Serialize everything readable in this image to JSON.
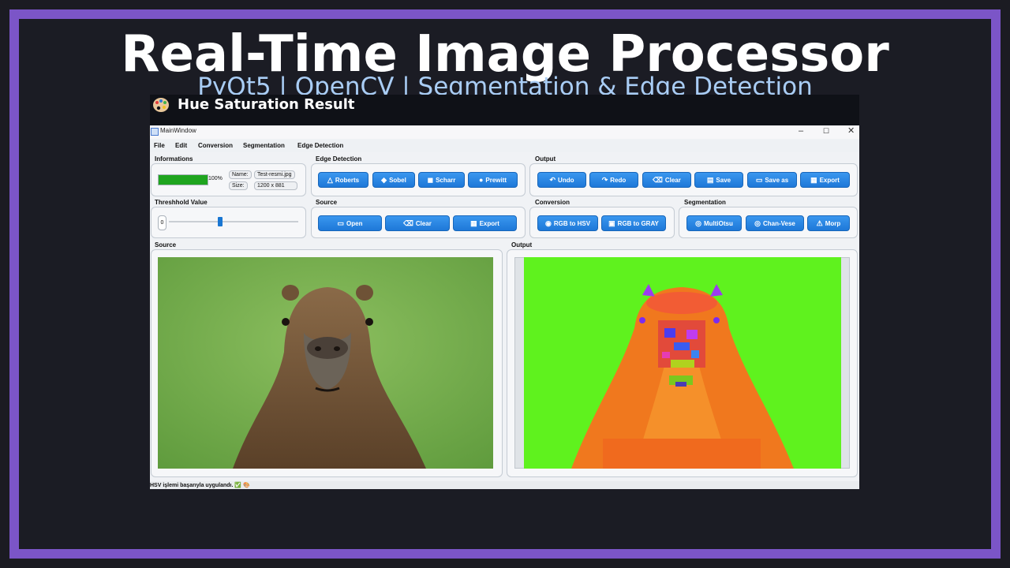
{
  "banner": {
    "title": "Real-Time Image Processor",
    "subtitle": "PyQt5 | OpenCV | Segmentation & Edge Detection"
  },
  "result_bar": {
    "title": "Hue Saturation Result",
    "icon": "palette-icon"
  },
  "window": {
    "title": "MainWindow",
    "controls": {
      "minimize": "–",
      "maximize": "☐",
      "close": "✕"
    }
  },
  "menu": [
    "File",
    "Edit",
    "Conversion",
    "Segmentation",
    "Edge Detection"
  ],
  "informations": {
    "label": "Informations",
    "progress": 1.0,
    "progress_text": "100%",
    "name_label": "Name:",
    "name_value": "Test-resmi.jpg",
    "size_label": "Size:",
    "size_value": "1200 x 881"
  },
  "edge_detection": {
    "label": "Edge Detection",
    "buttons": [
      "Roberts",
      "Sobel",
      "Scharr",
      "Prewitt"
    ]
  },
  "output_group": {
    "label": "Output",
    "buttons": [
      "Undo",
      "Redo",
      "Clear",
      "Save",
      "Save as",
      "Export"
    ]
  },
  "threshold": {
    "label": "Threshhold Value",
    "value": "0",
    "slider_fraction": 0.39
  },
  "source_group": {
    "label": "Source",
    "buttons": [
      "Open",
      "Clear",
      "Export"
    ]
  },
  "conversion": {
    "label": "Conversion",
    "buttons": [
      "RGB to HSV",
      "RGB to GRAY"
    ]
  },
  "segmentation": {
    "label": "Segmentation",
    "buttons": [
      "MultiOtsu",
      "Chan-Vese",
      "Morp"
    ]
  },
  "source_panel": {
    "label": "Source"
  },
  "output_panel": {
    "label": "Output"
  },
  "status": {
    "text": "HSV işlemi başarıyla uygulandı. ✅ 🎨"
  },
  "colors": {
    "frame": "#7b55c7",
    "background": "#1b1c24",
    "subtitle": "#a9cdf5",
    "button": "#1e78d8",
    "progress": "#1fa51f"
  }
}
